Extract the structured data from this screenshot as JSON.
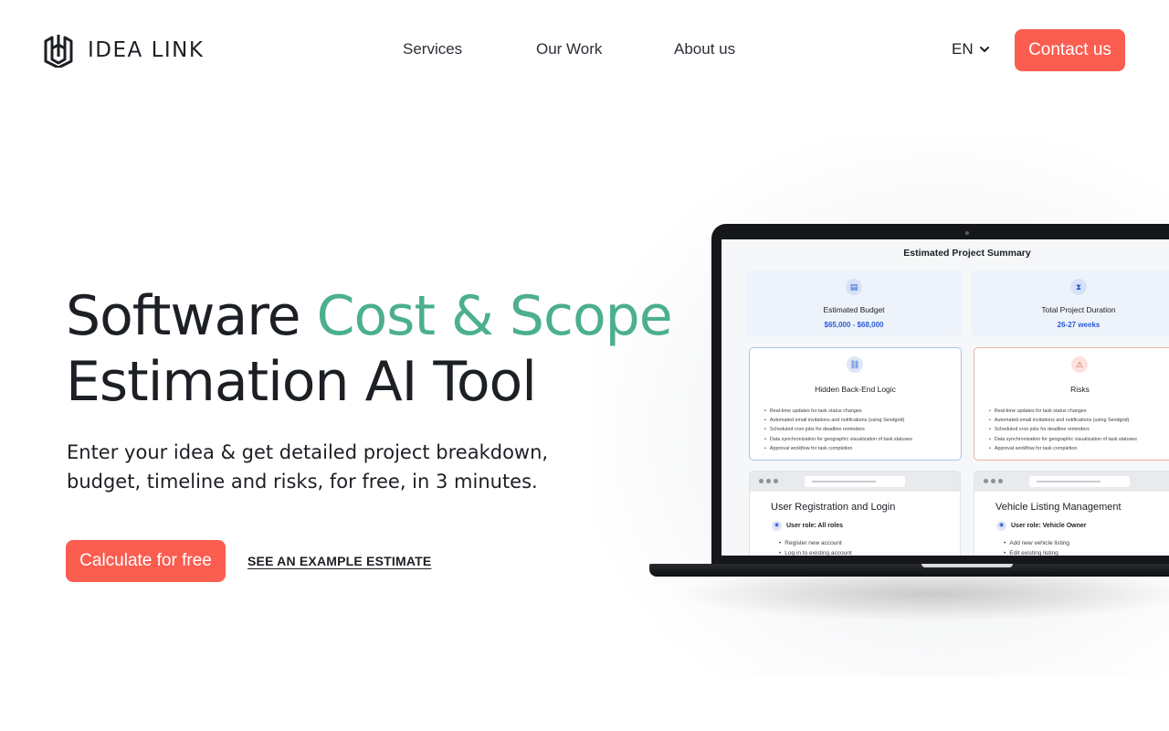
{
  "brand": {
    "name": "IDEA LINK"
  },
  "nav": {
    "items": [
      "Services",
      "Our Work",
      "About us"
    ]
  },
  "header": {
    "language": "EN",
    "contact_label": "Contact us"
  },
  "hero": {
    "title_part1": "Software ",
    "title_accent": "Cost & Scope",
    "title_part2": "Estimation AI Tool",
    "subtitle": "Enter your idea & get detailed project breakdown, budget, timeline and risks, for free, in 3 minutes.",
    "cta_label": "Calculate for free",
    "example_link": "SEE AN EXAMPLE ESTIMATE"
  },
  "preview": {
    "title": "Estimated Project Summary",
    "budget_label": "Estimated Budget",
    "budget_value": "$65,000 - $68,000",
    "duration_label": "Total Project Duration",
    "duration_value": "26-27 weeks",
    "backend_title": "Hidden Back-End Logic",
    "backend_items": [
      "Real-time updates for task status changes",
      "Automated email invitations and notifications (using Sendgrid)",
      "Scheduled cron jobs for deadline reminders",
      "Data synchronization for geographic visualization of task statuses",
      "Approval workflow for task completion"
    ],
    "risks_title": "Risks",
    "risks_items": [
      "Real-time updates for task status changes",
      "Automated email invitations and notifications (using Sendgrid)",
      "Scheduled cron jobs for deadline reminders",
      "Data synchronization for geographic visualization of task statuses",
      "Approval workflow for task completion"
    ],
    "module1_title": "User Registration and Login",
    "module1_role": "User role: All roles",
    "module1_items": [
      "Register new account",
      "Log in to existing account"
    ],
    "module2_title": "Vehicle Listing Management",
    "module2_role": "User role: Vehicle Owner",
    "module2_items": [
      "Add new vehicle listing",
      "Edit existing listing"
    ]
  },
  "colors": {
    "accent": "#fb5d50",
    "highlight": "#4caf8e",
    "link_blue": "#2a5bd7"
  },
  "icons": [
    "logo-icon",
    "chevron-down-icon",
    "budget-icon",
    "hourglass-icon",
    "logic-icon",
    "warning-icon",
    "user-icon"
  ]
}
